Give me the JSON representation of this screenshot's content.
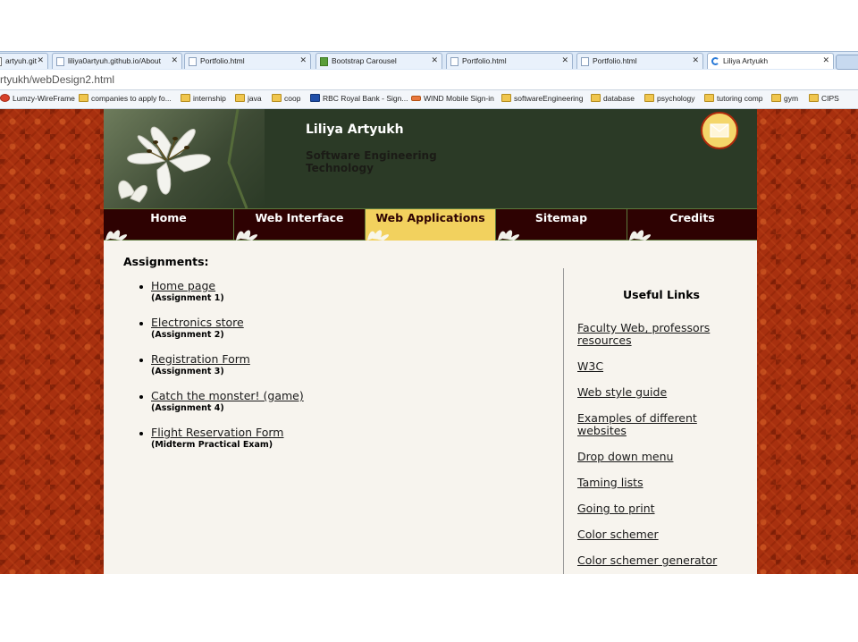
{
  "browser": {
    "tabs": [
      {
        "title": "artyuh.git"
      },
      {
        "title": "liliya0artyuh.github.io/About"
      },
      {
        "title": "Portfolio.html"
      },
      {
        "title": "Bootstrap Carousel"
      },
      {
        "title": "Portfolio.html"
      },
      {
        "title": "Portfolio.html"
      },
      {
        "title": "Liliya Artyukh"
      }
    ],
    "url": "rtyukh/webDesign2.html",
    "bookmarks": [
      {
        "label": "Lumzy-WireFrame",
        "icon": "lumzy-icon"
      },
      {
        "label": "companies to apply fo...",
        "icon": "folder-icon"
      },
      {
        "label": "internship",
        "icon": "folder-icon"
      },
      {
        "label": "java",
        "icon": "folder-icon"
      },
      {
        "label": "coop",
        "icon": "folder-icon"
      },
      {
        "label": "RBC Royal Bank - Sign...",
        "icon": "rbc-icon"
      },
      {
        "label": "WIND Mobile Sign-in",
        "icon": "wind-icon"
      },
      {
        "label": "softwareEngineering",
        "icon": "folder-icon"
      },
      {
        "label": "database",
        "icon": "folder-icon"
      },
      {
        "label": "psychology",
        "icon": "folder-icon"
      },
      {
        "label": "tutoring comp",
        "icon": "folder-icon"
      },
      {
        "label": "gym",
        "icon": "folder-icon"
      },
      {
        "label": "CIPS",
        "icon": "folder-icon"
      }
    ]
  },
  "header": {
    "name": "Liliya Artyukh",
    "subtitle": "Software Engineering Technology",
    "mail_icon": "envelope-icon"
  },
  "nav": [
    {
      "label": "Home"
    },
    {
      "label": "Web Interface"
    },
    {
      "label": "Web Applications",
      "active": true
    },
    {
      "label": "Sitemap"
    },
    {
      "label": "Credits"
    }
  ],
  "assignments": {
    "title": "Assignments:",
    "items": [
      {
        "link": "Home page",
        "note": "(Assignment 1)"
      },
      {
        "link": "Electronics store",
        "note": "(Assignment 2)"
      },
      {
        "link": "Registration Form",
        "note": "(Assignment 3)"
      },
      {
        "link": "Catch the monster! (game)",
        "note": "(Assignment 4)"
      },
      {
        "link": "Flight Reservation Form",
        "note": "(Midterm Practical Exam)"
      }
    ]
  },
  "useful_links": {
    "title": "Useful Links",
    "items": [
      "Faculty Web, professors resources",
      "W3C",
      "Web style guide",
      "Examples of different websites",
      "Drop down menu",
      "Taming lists",
      "Going to print",
      "Color schemer",
      "Color schemer generator"
    ]
  },
  "colors": {
    "header_bg": "#2b3a26",
    "nav_bg": "#2e0202",
    "nav_active": "#f2d15e",
    "page_bg": "#a8300f",
    "content_bg": "#f7f4ee"
  }
}
